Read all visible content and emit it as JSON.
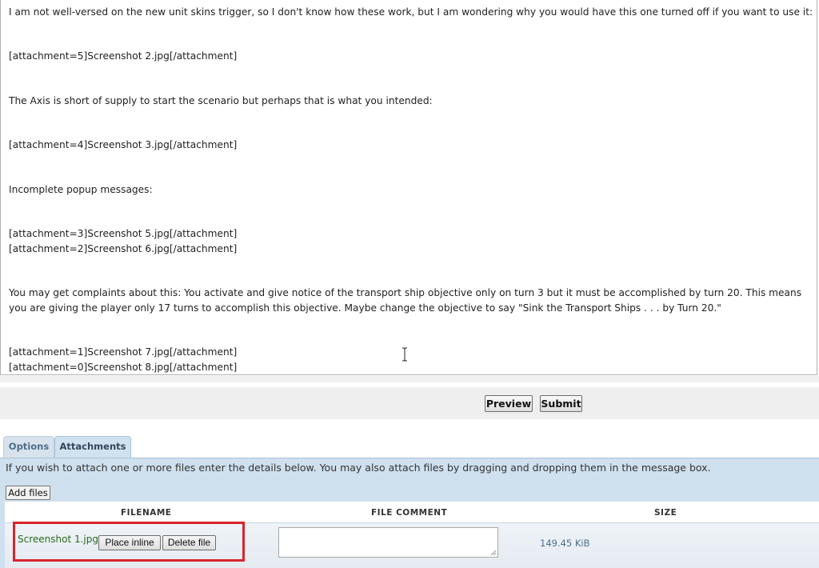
{
  "editor": {
    "lines": [
      "I am not well-versed on the new unit skins trigger, so I don't know how these work, but I am wondering why you would have this one turned off if you want to use it:",
      "[attachment=5]Screenshot 2.jpg[/attachment]",
      "The Axis is short of supply to start the scenario but perhaps that is what you intended:",
      "[attachment=4]Screenshot 3.jpg[/attachment]",
      "Incomplete popup messages:",
      "[attachment=3]Screenshot 5.jpg[/attachment]",
      "[attachment=2]Screenshot 6.jpg[/attachment]",
      "You may get complaints about this:  You activate and give notice of the transport ship objective only on turn 3 but it must be accomplished by turn 20.  This means you are giving the player only 17 turns to accomplish this objective.  Maybe change the objective to say \"Sink the Transport Ships . . . by Turn 20.\"",
      "[attachment=1]Screenshot 7.jpg[/attachment]",
      "[attachment=0]Screenshot 8.jpg[/attachment]"
    ]
  },
  "toolbar": {
    "preview_label": "Preview",
    "submit_label": "Submit"
  },
  "tabs": [
    {
      "label": "Options",
      "active": false
    },
    {
      "label": "Attachments",
      "active": true
    }
  ],
  "attachments": {
    "info": "If you wish to attach one or more files enter the details below. You may also attach files by dragging and dropping them in the message box.",
    "add_files_label": "Add files",
    "columns": {
      "filename": "FILENAME",
      "comment": "FILE COMMENT",
      "size": "SIZE"
    },
    "files": [
      {
        "filename": "Screenshot 1.jpg",
        "place_inline_label": "Place inline",
        "delete_label": "Delete file",
        "comment": "",
        "size": "149.45 KiB"
      }
    ]
  },
  "colors": {
    "panel_bg": "#cfe0ee",
    "highlight": "#d8242e",
    "filename_text": "#2b6a1d"
  }
}
